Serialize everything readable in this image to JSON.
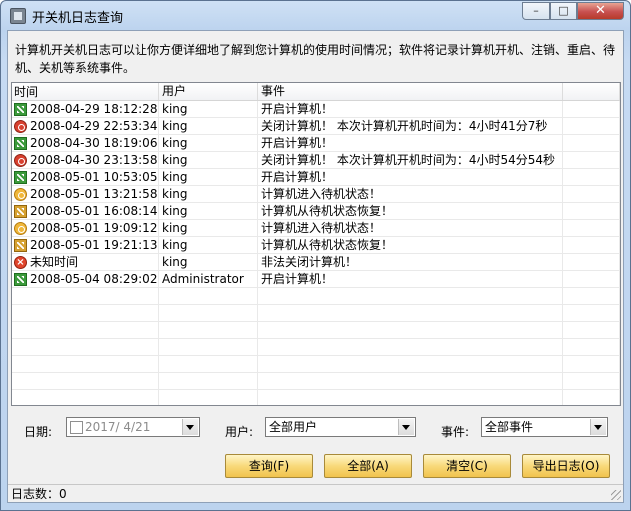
{
  "window": {
    "title": "开关机日志查询"
  },
  "description": "计算机开关机日志可以让你方便详细地了解到您计算机的使用时间情况；软件将记录计算机开机、注销、重启、待机、关机等系统事件。",
  "table": {
    "columns": [
      "时间",
      "用户",
      "事件"
    ],
    "rows": [
      {
        "icon": "startup-icon",
        "time": "2008-04-29 18:12:28",
        "user": "king",
        "event": "开启计算机！"
      },
      {
        "icon": "shutdown-icon",
        "time": "2008-04-29 22:53:34",
        "user": "king",
        "event": "关闭计算机！ 本次计算机开机时间为：4小时41分7秒"
      },
      {
        "icon": "startup-icon",
        "time": "2008-04-30 18:19:06",
        "user": "king",
        "event": "开启计算机！"
      },
      {
        "icon": "shutdown-icon",
        "time": "2008-04-30 23:13:58",
        "user": "king",
        "event": "关闭计算机！ 本次计算机开机时间为：4小时54分54秒"
      },
      {
        "icon": "startup-icon",
        "time": "2008-05-01 10:53:05",
        "user": "king",
        "event": "开启计算机！"
      },
      {
        "icon": "standby-icon",
        "time": "2008-05-01 13:21:58",
        "user": "king",
        "event": "计算机进入待机状态！"
      },
      {
        "icon": "resume-icon",
        "time": "2008-05-01 16:08:14",
        "user": "king",
        "event": "计算机从待机状态恢复！"
      },
      {
        "icon": "standby-icon",
        "time": "2008-05-01 19:09:12",
        "user": "king",
        "event": "计算机进入待机状态！"
      },
      {
        "icon": "resume-icon",
        "time": "2008-05-01 19:21:13",
        "user": "king",
        "event": "计算机从待机状态恢复！"
      },
      {
        "icon": "error-icon",
        "time": "未知时间",
        "user": "king",
        "event": "非法关闭计算机！"
      },
      {
        "icon": "startup-icon",
        "time": "2008-05-04 08:29:02",
        "user": "Administrator",
        "event": "开启计算机！"
      }
    ]
  },
  "filters": {
    "date_label": "日期:",
    "date_value": "2017/ 4/21",
    "user_label": "用户:",
    "user_value": "全部用户",
    "event_label": "事件:",
    "event_value": "全部事件"
  },
  "buttons": {
    "query": "查询(F)",
    "all": "全部(A)",
    "clear": "清空(C)",
    "export": "导出日志(O)"
  },
  "status": {
    "log_count": "日志数：0"
  }
}
